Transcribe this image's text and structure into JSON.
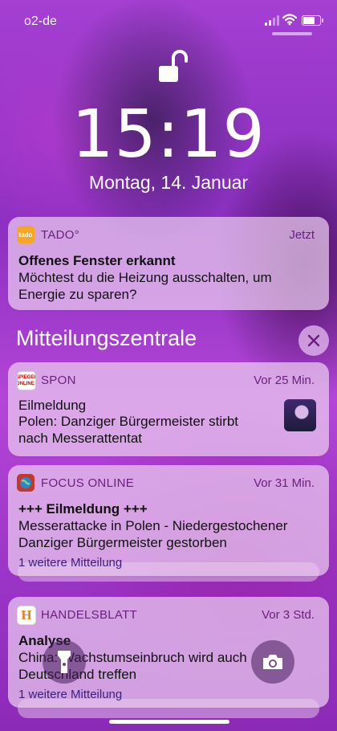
{
  "status": {
    "carrier": "o2-de"
  },
  "lock": {
    "time": "15:19",
    "date": "Montag, 14. Januar"
  },
  "notifications": [
    {
      "app": "TADO°",
      "time": "Jetzt",
      "title": "Offenes Fenster erkannt",
      "body1": "Möchtest du die Heizung ausschalten, um",
      "body2": "Energie zu sparen?"
    }
  ],
  "center": {
    "title": "Mitteilungszentrale",
    "items": [
      {
        "app": "SPON",
        "icon_text": "SPIEGEL ONLINE",
        "time": "Vor 25 Min.",
        "title": "Eilmeldung",
        "body1": "Polen: Danziger Bürgermeister stirbt",
        "body2": "nach Messerattentat"
      },
      {
        "app": "FOCUS ONLINE",
        "time": "Vor 31 Min.",
        "title": "+++ Eilmeldung +++",
        "body1": "Messerattacke in Polen - Niedergestochener",
        "body2": "Danziger Bürgermeister gestorben",
        "more": "1 weitere Mitteilung"
      },
      {
        "app": "HANDELSBLATT",
        "icon_text": "H",
        "time": "Vor 3 Std.",
        "title": "Analyse",
        "body1": "China: Wachstumseinbruch wird auch",
        "body2": "Deutschland treffen",
        "more": "1 weitere Mitteilung"
      }
    ]
  },
  "icons": {
    "flashlight": "flashlight-icon",
    "camera": "camera-icon",
    "close": "close-icon",
    "lock": "lock-open-icon"
  }
}
